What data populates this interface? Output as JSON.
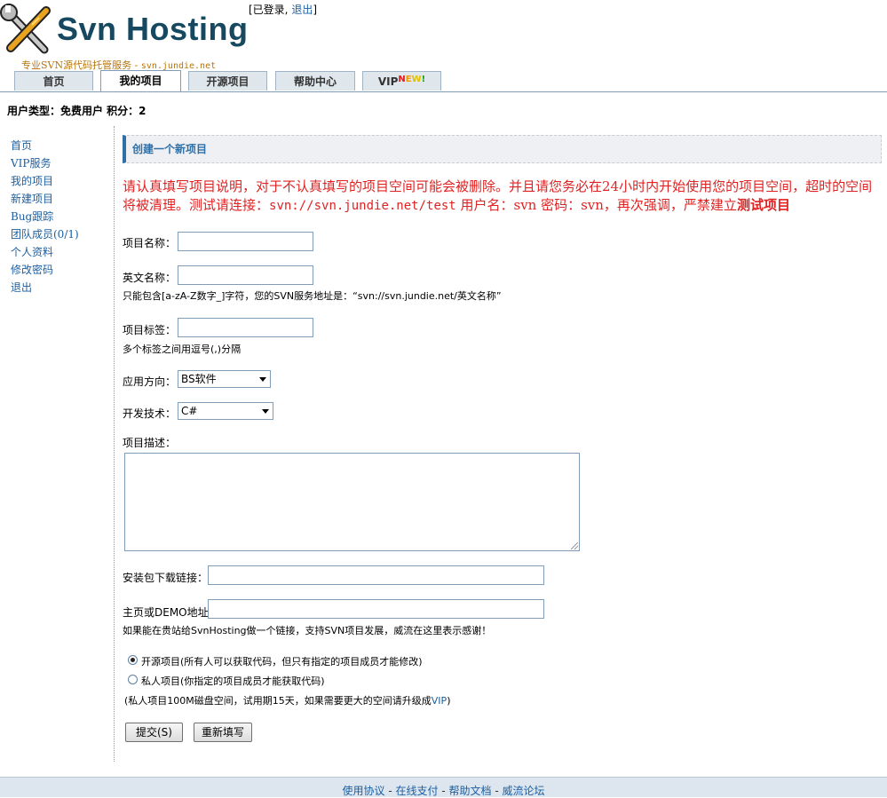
{
  "header": {
    "logo_text": "Svn Hosting",
    "login_prefix": "[已登录,",
    "logout_label": "退出",
    "login_suffix": "]",
    "tagline": "专业SVN源代码托管服务 -",
    "tagline_url": "svn.jundie.net"
  },
  "tabs": {
    "home": "首页",
    "my_projects": "我的项目",
    "open_source": "开源项目",
    "help": "帮助中心",
    "vip": "VIP",
    "vip_badge": [
      "N",
      "E",
      "W",
      "!"
    ]
  },
  "user_info": "用户类型：免费用户  积分：2",
  "sidebar": {
    "items": [
      "首页",
      "VIP服务",
      "我的项目",
      "新建项目",
      "Bug跟踪",
      "团队成员(0/1)",
      "个人资料",
      "修改密码",
      "退出"
    ]
  },
  "main": {
    "section_title": "创建一个新项目",
    "warning_part1": "请认真填写项目说明，对于不认真填写的项目空间可能会被删除。并且请您务必在24小时内开始使用您的项目空间，超时的空间将被清理。测试请连接：",
    "warning_url": "svn://svn.jundie.net/test",
    "warning_part2": " 用户名：svn 密码：svn，再次强调，严禁建立",
    "warning_bold": "测试项目",
    "project_name_label": "项目名称：",
    "project_name_value": "",
    "english_name_label": "英文名称：",
    "english_name_value": "",
    "english_name_hint": "只能包含[a-zA-Z数字_]字符，您的SVN服务地址是：“svn://svn.jundie.net/英文名称”",
    "tags_label": "项目标签：",
    "tags_value": "",
    "tags_hint": "多个标签之间用逗号(,)分隔",
    "app_dir_label": "应用方向：",
    "app_dir_value": "BS软件",
    "tech_label": "开发技术：",
    "tech_value": "C#",
    "desc_label": "项目描述：",
    "download_label": "安装包下载链接：",
    "download_value": "",
    "homepage_label": "主页或DEMO地址：",
    "homepage_value": "",
    "link_hint": "如果能在贵站给SvnHosting做一个链接，支持SVN项目发展，威流在这里表示感谢！",
    "radio_open": "开源项目(所有人可以获取代码，但只有指定的项目成员才能修改)",
    "radio_private": "私人项目(你指定的项目成员才能获取代码)",
    "private_note_prefix": "(私人项目100M磁盘空间，试用期15天，如果需要更大的空间请升级成",
    "private_note_vip": "VIP",
    "private_note_suffix": ")",
    "submit_label": "提交(S)",
    "reset_label": "重新填写"
  },
  "footer": {
    "links": [
      "使用协议",
      "在线支付",
      "帮助文档",
      "威流论坛"
    ],
    "separator": " - "
  }
}
